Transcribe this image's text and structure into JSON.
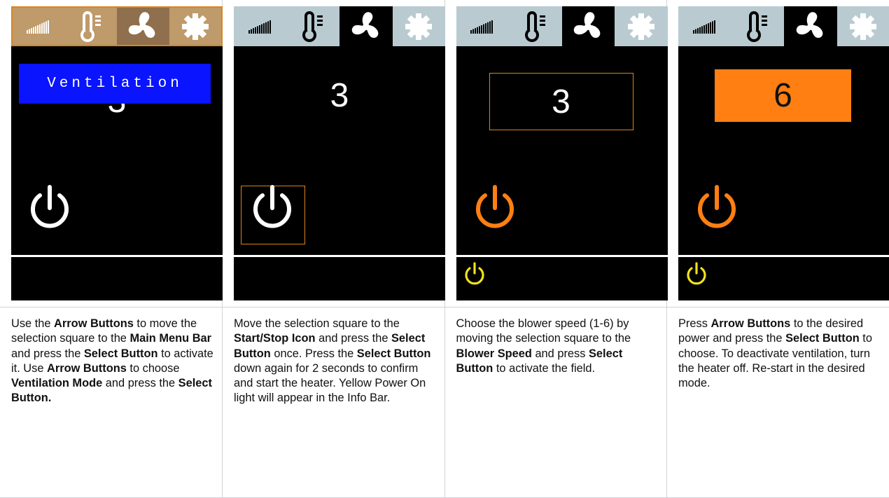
{
  "panels": [
    {
      "screen": {
        "mode_label": "Ventilation",
        "speed_value": "3"
      },
      "description": [
        {
          "t": "Use the ",
          "b": false
        },
        {
          "t": "Arrow Buttons",
          "b": true
        },
        {
          "t": " to move the selection square to the ",
          "b": false
        },
        {
          "t": "Main Menu Bar",
          "b": true
        },
        {
          "t": " and press the ",
          "b": false
        },
        {
          "t": "Select Button",
          "b": true
        },
        {
          "t": " to activate it. Use ",
          "b": false
        },
        {
          "t": "Arrow Buttons",
          "b": true
        },
        {
          "t": " to choose ",
          "b": false
        },
        {
          "t": "Ventilation Mode",
          "b": true
        },
        {
          "t": " and press the ",
          "b": false
        },
        {
          "t": "Select Button.",
          "b": true
        }
      ]
    },
    {
      "screen": {
        "speed_value": "3"
      },
      "description": [
        {
          "t": "Move the selection square to the ",
          "b": false
        },
        {
          "t": "Start/Stop Icon",
          "b": true
        },
        {
          "t": " and press the ",
          "b": false
        },
        {
          "t": "Select Button",
          "b": true
        },
        {
          "t": " once. Press the ",
          "b": false
        },
        {
          "t": "Select Button",
          "b": true
        },
        {
          "t": " down again for 2 seconds to confirm and start the heater. Yellow Power On light will appear in the Info Bar.",
          "b": false
        }
      ]
    },
    {
      "screen": {
        "speed_value": "3"
      },
      "description": [
        {
          "t": "Choose the blower speed (1-6) by moving the selection square to the ",
          "b": false
        },
        {
          "t": "Blower Speed",
          "b": true
        },
        {
          "t": " and press ",
          "b": false
        },
        {
          "t": "Select Button",
          "b": true
        },
        {
          "t": " to activate the field.",
          "b": false
        }
      ]
    },
    {
      "screen": {
        "speed_value": "6"
      },
      "description": [
        {
          "t": "Press ",
          "b": false
        },
        {
          "t": "Arrow Buttons",
          "b": true
        },
        {
          "t": " to the desired power and press the ",
          "b": false
        },
        {
          "t": "Select Button",
          "b": true
        },
        {
          "t": " to choose. To deactivate ventilation, turn the heater off. Re-start in the desired mode.",
          "b": false
        }
      ]
    }
  ],
  "colors": {
    "menu_active_bg": "#bf9a6a",
    "menu_normal_bg": "#b9cbd1",
    "selection_orange": "#d9861a",
    "speed_fill_orange": "#ff7f12",
    "power_orange": "#ff7f12",
    "info_power_yellow": "#f2e21a",
    "mode_label_blue": "#0a14ff"
  },
  "icons": [
    "signal-bars-icon",
    "thermometer-icon",
    "fan-icon",
    "gear-icon",
    "power-icon"
  ]
}
